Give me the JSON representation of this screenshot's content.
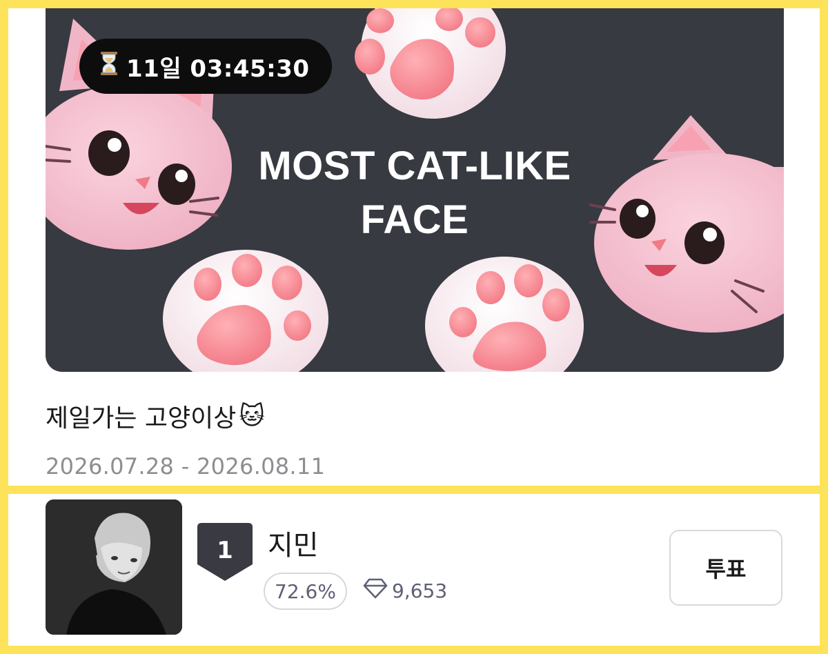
{
  "event": {
    "countdown": "11일 03:45:30",
    "banner_title_line1": "MOST CAT-LIKE",
    "banner_title_line2": "FACE",
    "title": "제일가는 고양이상",
    "title_emoji": "🐱",
    "dates": "2026.07.28 - 2026.08.11"
  },
  "ranking": {
    "rank": "1",
    "name": "지민",
    "percent": "72.6%",
    "votes": "9,653",
    "vote_button_label": "투표"
  },
  "icons": {
    "timer": "hourglass-icon",
    "votes": "diamond-icon",
    "title": "cat-face-emoji"
  },
  "colors": {
    "page_background": "#fde35a",
    "banner_background": "#373a40",
    "badge": "#3a3a42",
    "muted_text": "#8d8d92"
  }
}
